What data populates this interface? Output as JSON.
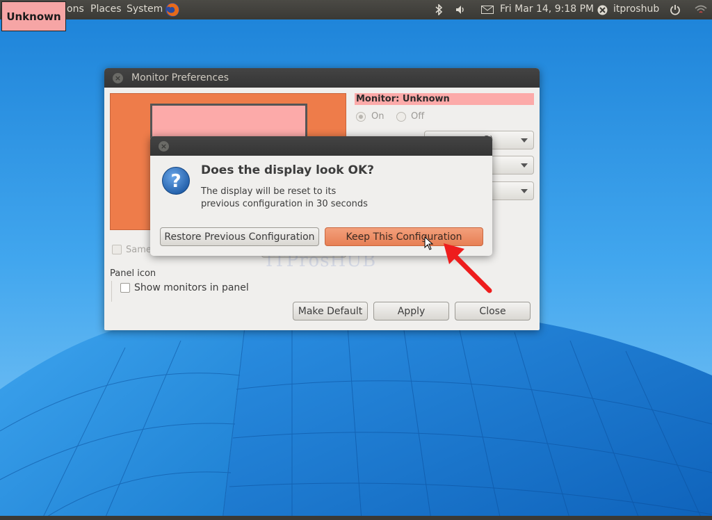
{
  "panel": {
    "unknown_label": "Unknown",
    "menu_applications": "ons",
    "menu_places": "Places",
    "menu_system": "System",
    "datetime": "Fri Mar 14,  9:18 PM",
    "username": "itproshub"
  },
  "monitor_prefs": {
    "title": "Monitor Preferences",
    "monitor_heading": "Monitor: Unknown",
    "on_label": "On",
    "off_label": "Off",
    "resolution_partial": "3)",
    "same_image_label": "Same",
    "panel_icon_heading": "Panel icon",
    "show_monitors_label": "Show monitors in panel",
    "make_default_label": "Make Default",
    "apply_label": "Apply",
    "close_label": "Close",
    "watermark": "ITProsHUB"
  },
  "confirm_dialog": {
    "heading": "Does the display look OK?",
    "message_line1": "The display will be reset to its",
    "message_line2": "previous configuration in 30 seconds",
    "restore_label": "Restore Previous Configuration",
    "keep_label": "Keep This Configuration"
  },
  "colors": {
    "monitor_area": "#ee7c4a",
    "monitor_rect": "#fcaaa9",
    "keep_button": "#ec8b63",
    "arrow": "#ee1d1d"
  }
}
